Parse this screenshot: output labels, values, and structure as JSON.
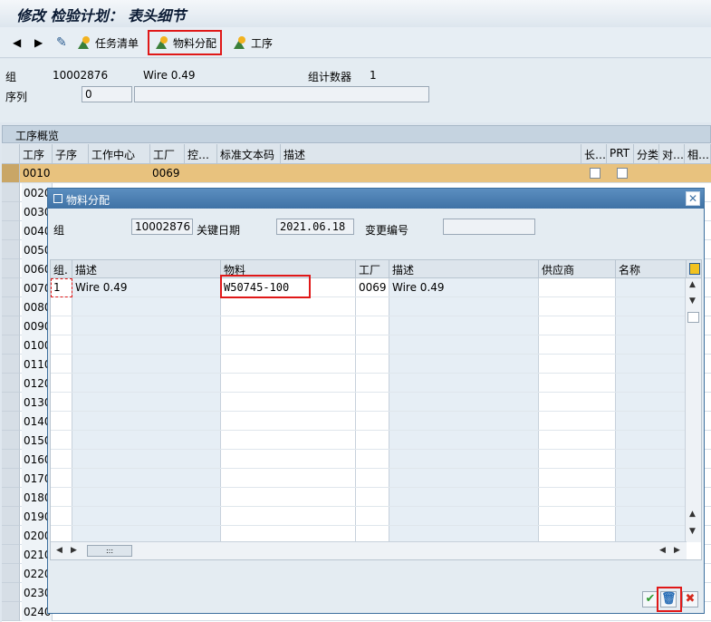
{
  "window": {
    "title": "修改 检验计划： 表头细节"
  },
  "toolbar": {
    "task_list_label": "任务清单",
    "material_assign_label": "物料分配",
    "operation_label": "工序"
  },
  "header": {
    "group_label": "组",
    "group_value": "10002876",
    "group_desc": "Wire 0.49",
    "counter_label": "组计数器",
    "counter_value": "1",
    "seq_label": "序列",
    "seq_value": "0"
  },
  "overview": {
    "section_title": "工序概览",
    "columns": [
      "工序",
      "子序",
      "工作中心",
      "工厂",
      "控…",
      "标准文本码",
      "描述",
      "长…",
      "PRT",
      "分类",
      "对…",
      "相…"
    ],
    "row1": {
      "op": "0010",
      "plant": "0069"
    },
    "op_numbers": [
      "0020",
      "0030",
      "0040",
      "0050",
      "0060",
      "0070",
      "0080",
      "0090",
      "0100",
      "0110",
      "0120",
      "0130",
      "0140",
      "0150",
      "0160",
      "0170",
      "0180",
      "0190",
      "0200",
      "0210",
      "0220",
      "0230",
      "0240"
    ]
  },
  "dialog": {
    "title": "物料分配",
    "group_label": "组",
    "group_value": "10002876",
    "key_date_label": "关键日期",
    "key_date_value": "2021.06.18",
    "change_no_label": "变更编号",
    "change_no_value": "",
    "columns": [
      "组.",
      "描述",
      "物料",
      "工厂",
      "描述",
      "供应商",
      "名称"
    ],
    "row": {
      "group_counter": "1",
      "desc": "Wire 0.49",
      "material": "W50745-100",
      "plant": "0069",
      "plant_desc": "Wire 0.49",
      "vendor": "",
      "name": ""
    },
    "hscroll_handle": ":::"
  },
  "colors": {
    "highlight_row": "#e8c27e",
    "red_frame": "#e01818",
    "title_blue": "#3f72a5"
  }
}
